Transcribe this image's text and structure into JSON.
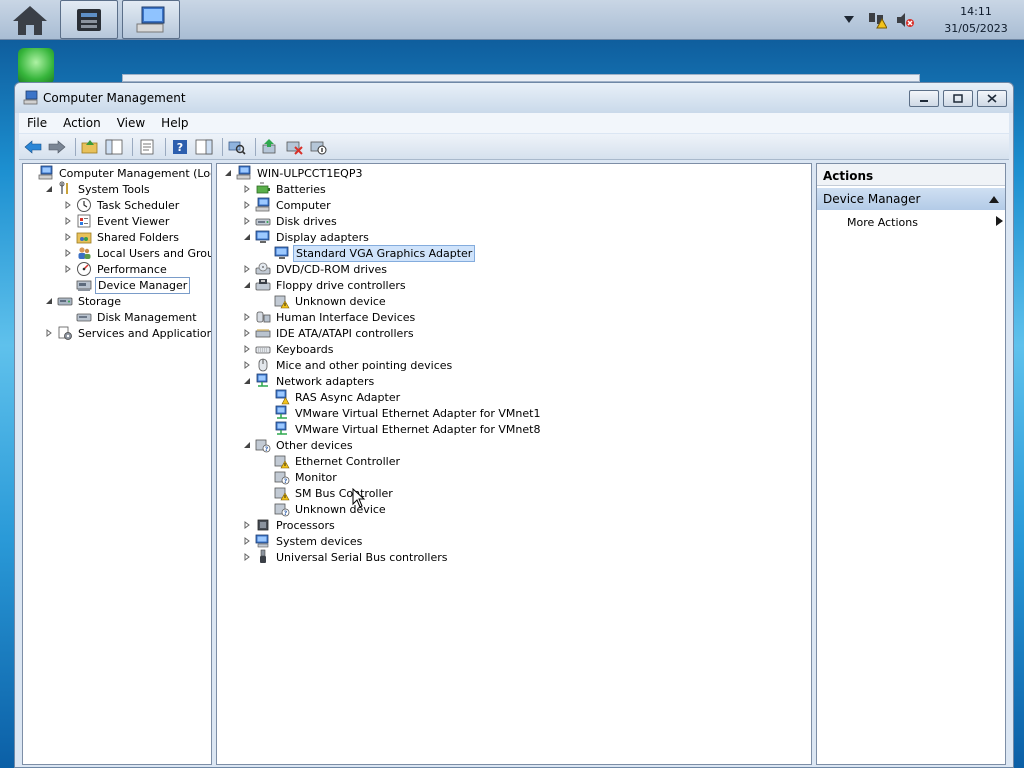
{
  "taskbar": {
    "time": "14:11",
    "date": "31/05/2023"
  },
  "window": {
    "title": "Computer Management"
  },
  "menu": [
    "File",
    "Action",
    "View",
    "Help"
  ],
  "left_tree": [
    {
      "label": "Computer Management (Local)",
      "indent": 0,
      "expander": "",
      "icon": "computer-management-icon"
    },
    {
      "label": "System Tools",
      "indent": 1,
      "expander": "open",
      "icon": "tools-icon"
    },
    {
      "label": "Task Scheduler",
      "indent": 2,
      "expander": "closed",
      "icon": "clock-icon"
    },
    {
      "label": "Event Viewer",
      "indent": 2,
      "expander": "closed",
      "icon": "event-viewer-icon"
    },
    {
      "label": "Shared Folders",
      "indent": 2,
      "expander": "closed",
      "icon": "shared-folder-icon"
    },
    {
      "label": "Local Users and Groups",
      "indent": 2,
      "expander": "closed",
      "icon": "users-icon"
    },
    {
      "label": "Performance",
      "indent": 2,
      "expander": "closed",
      "icon": "performance-icon"
    },
    {
      "label": "Device Manager",
      "indent": 2,
      "expander": "",
      "icon": "device-manager-icon",
      "selected": true
    },
    {
      "label": "Storage",
      "indent": 1,
      "expander": "open",
      "icon": "storage-icon"
    },
    {
      "label": "Disk Management",
      "indent": 2,
      "expander": "",
      "icon": "disk-icon"
    },
    {
      "label": "Services and Applications",
      "indent": 1,
      "expander": "closed",
      "icon": "services-icon"
    }
  ],
  "device_tree": [
    {
      "label": "WIN-ULPCCT1EQP3",
      "indent": 0,
      "expander": "open",
      "icon": "computer-icon"
    },
    {
      "label": "Batteries",
      "indent": 1,
      "expander": "closed",
      "icon": "battery-icon"
    },
    {
      "label": "Computer",
      "indent": 1,
      "expander": "closed",
      "icon": "computer-icon"
    },
    {
      "label": "Disk drives",
      "indent": 1,
      "expander": "closed",
      "icon": "disk-drive-icon"
    },
    {
      "label": "Display adapters",
      "indent": 1,
      "expander": "open",
      "icon": "display-icon"
    },
    {
      "label": "Standard VGA Graphics Adapter",
      "indent": 2,
      "expander": "",
      "icon": "display-icon",
      "selected": true
    },
    {
      "label": "DVD/CD-ROM drives",
      "indent": 1,
      "expander": "closed",
      "icon": "dvd-icon"
    },
    {
      "label": "Floppy drive controllers",
      "indent": 1,
      "expander": "open",
      "icon": "floppy-controller-icon"
    },
    {
      "label": "Unknown device",
      "indent": 2,
      "expander": "",
      "icon": "warning-device-icon"
    },
    {
      "label": "Human Interface Devices",
      "indent": 1,
      "expander": "closed",
      "icon": "hid-icon"
    },
    {
      "label": "IDE ATA/ATAPI controllers",
      "indent": 1,
      "expander": "closed",
      "icon": "ide-icon"
    },
    {
      "label": "Keyboards",
      "indent": 1,
      "expander": "closed",
      "icon": "keyboard-icon"
    },
    {
      "label": "Mice and other pointing devices",
      "indent": 1,
      "expander": "closed",
      "icon": "mouse-icon"
    },
    {
      "label": "Network adapters",
      "indent": 1,
      "expander": "open",
      "icon": "network-icon"
    },
    {
      "label": "RAS Async Adapter",
      "indent": 2,
      "expander": "",
      "icon": "warning-network-icon"
    },
    {
      "label": "VMware Virtual Ethernet Adapter for VMnet1",
      "indent": 2,
      "expander": "",
      "icon": "network-icon"
    },
    {
      "label": "VMware Virtual Ethernet Adapter for VMnet8",
      "indent": 2,
      "expander": "",
      "icon": "network-icon"
    },
    {
      "label": "Other devices",
      "indent": 1,
      "expander": "open",
      "icon": "unknown-device-icon"
    },
    {
      "label": "Ethernet Controller",
      "indent": 2,
      "expander": "",
      "icon": "warning-device-icon"
    },
    {
      "label": "Monitor",
      "indent": 2,
      "expander": "",
      "icon": "unknown-device-icon"
    },
    {
      "label": "SM Bus Controller",
      "indent": 2,
      "expander": "",
      "icon": "warning-device-icon"
    },
    {
      "label": "Unknown device",
      "indent": 2,
      "expander": "",
      "icon": "unknown-device-icon"
    },
    {
      "label": "Processors",
      "indent": 1,
      "expander": "closed",
      "icon": "processor-icon"
    },
    {
      "label": "System devices",
      "indent": 1,
      "expander": "closed",
      "icon": "system-devices-icon"
    },
    {
      "label": "Universal Serial Bus controllers",
      "indent": 1,
      "expander": "closed",
      "icon": "usb-icon"
    }
  ],
  "actions": {
    "header": "Actions",
    "section": "Device Manager",
    "more": "More Actions"
  },
  "colors": {
    "selection": "#cfe3fb",
    "accent": "#84acdd",
    "warning": "#f2c31b"
  }
}
